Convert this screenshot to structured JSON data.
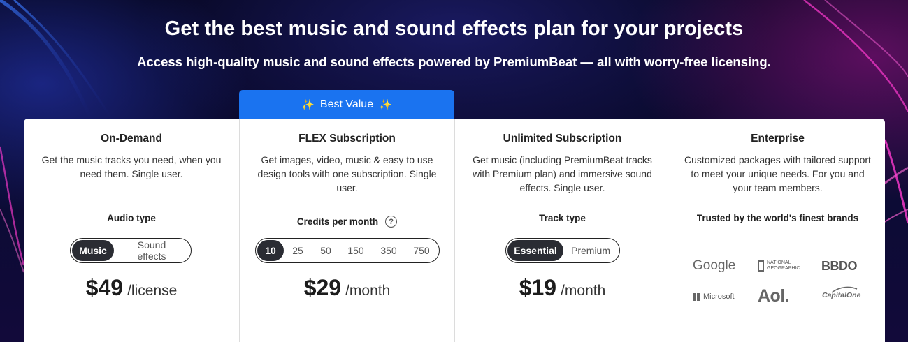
{
  "hero": {
    "title": "Get the best music and sound effects plan for your projects",
    "subtitle": "Access high-quality music and sound effects powered by PremiumBeat — all with worry-free licensing."
  },
  "badge": {
    "label": "Best Value",
    "icon": "sparkles-icon"
  },
  "plans": [
    {
      "title": "On-Demand",
      "description": "Get the music tracks you need, when you need them. Single user.",
      "option_label": "Audio type",
      "options": [
        "Music",
        "Sound effects"
      ],
      "selected": "Music",
      "price": "$49",
      "unit": "/license"
    },
    {
      "title": "FLEX Subscription",
      "description": "Get images, video, music & easy to use design tools with one subscription. Single user.",
      "option_label": "Credits per month",
      "options": [
        "10",
        "25",
        "50",
        "150",
        "350",
        "750"
      ],
      "selected": "10",
      "price": "$29",
      "unit": "/month"
    },
    {
      "title": "Unlimited Subscription",
      "description": "Get music (including PremiumBeat tracks with Premium plan) and immersive sound effects. Single user.",
      "option_label": "Track type",
      "options": [
        "Essential",
        "Premium"
      ],
      "selected": "Essential",
      "price": "$19",
      "unit": "/month"
    },
    {
      "title": "Enterprise",
      "description": "Customized packages with tailored support to meet your unique needs. For you and your team members.",
      "brands_label": "Trusted by the world's finest brands",
      "brands": [
        "Google",
        "NATIONAL GEOGRAPHIC",
        "BBDO",
        "Microsoft",
        "Aol.",
        "CapitalOne"
      ]
    }
  ],
  "colors": {
    "accent": "#1a73f0",
    "toggle_active": "#2a2c33"
  }
}
